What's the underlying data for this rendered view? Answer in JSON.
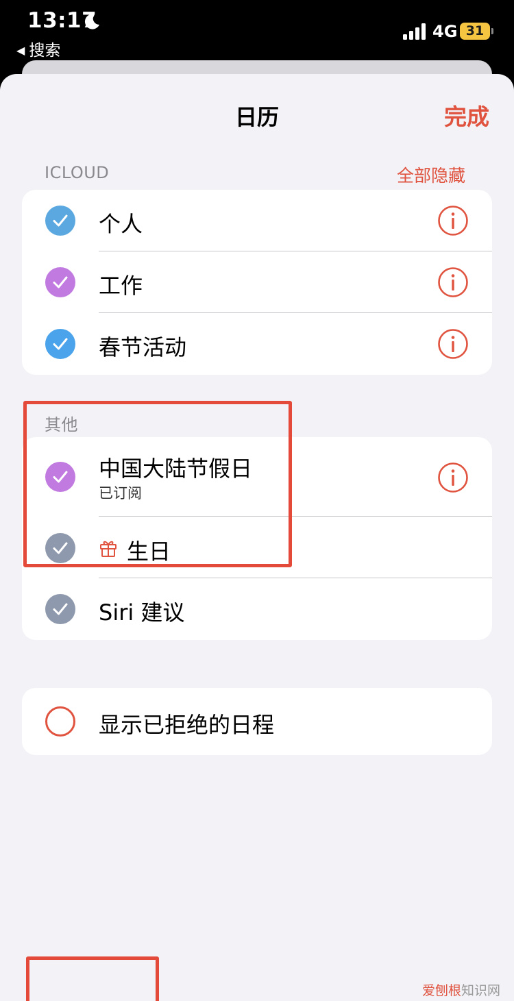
{
  "status_bar": {
    "time": "13:17",
    "back_label": "搜索",
    "network": "4G",
    "battery": "31"
  },
  "nav": {
    "title": "日历",
    "done_label": "完成"
  },
  "icloud_section": {
    "header": "ICLOUD",
    "action_label": "全部隐藏",
    "items": [
      {
        "label": "个人",
        "color": "#5aa8df",
        "checked": true
      },
      {
        "label": "工作",
        "color": "#c17ae0",
        "checked": true
      },
      {
        "label": "春节活动",
        "color": "#4aa3eb",
        "checked": true
      }
    ]
  },
  "other_section": {
    "header": "其他",
    "items": [
      {
        "label": "中国大陆节假日",
        "subtitle": "已订阅",
        "color": "#c17ae0",
        "checked": true
      },
      {
        "label": "生日",
        "color": "#8e99ad",
        "checked": true,
        "icon": "gift-icon"
      },
      {
        "label": "Siri 建议",
        "color": "#8e99ad",
        "checked": true
      }
    ]
  },
  "declined": {
    "label": "显示已拒绝的日程",
    "checked": false
  },
  "watermark": {
    "part1": "爱刨根",
    "part2": "知识网"
  },
  "colors": {
    "accent": "#e0533f",
    "annotation": "#e34a3a",
    "background": "#f2f2f7"
  }
}
